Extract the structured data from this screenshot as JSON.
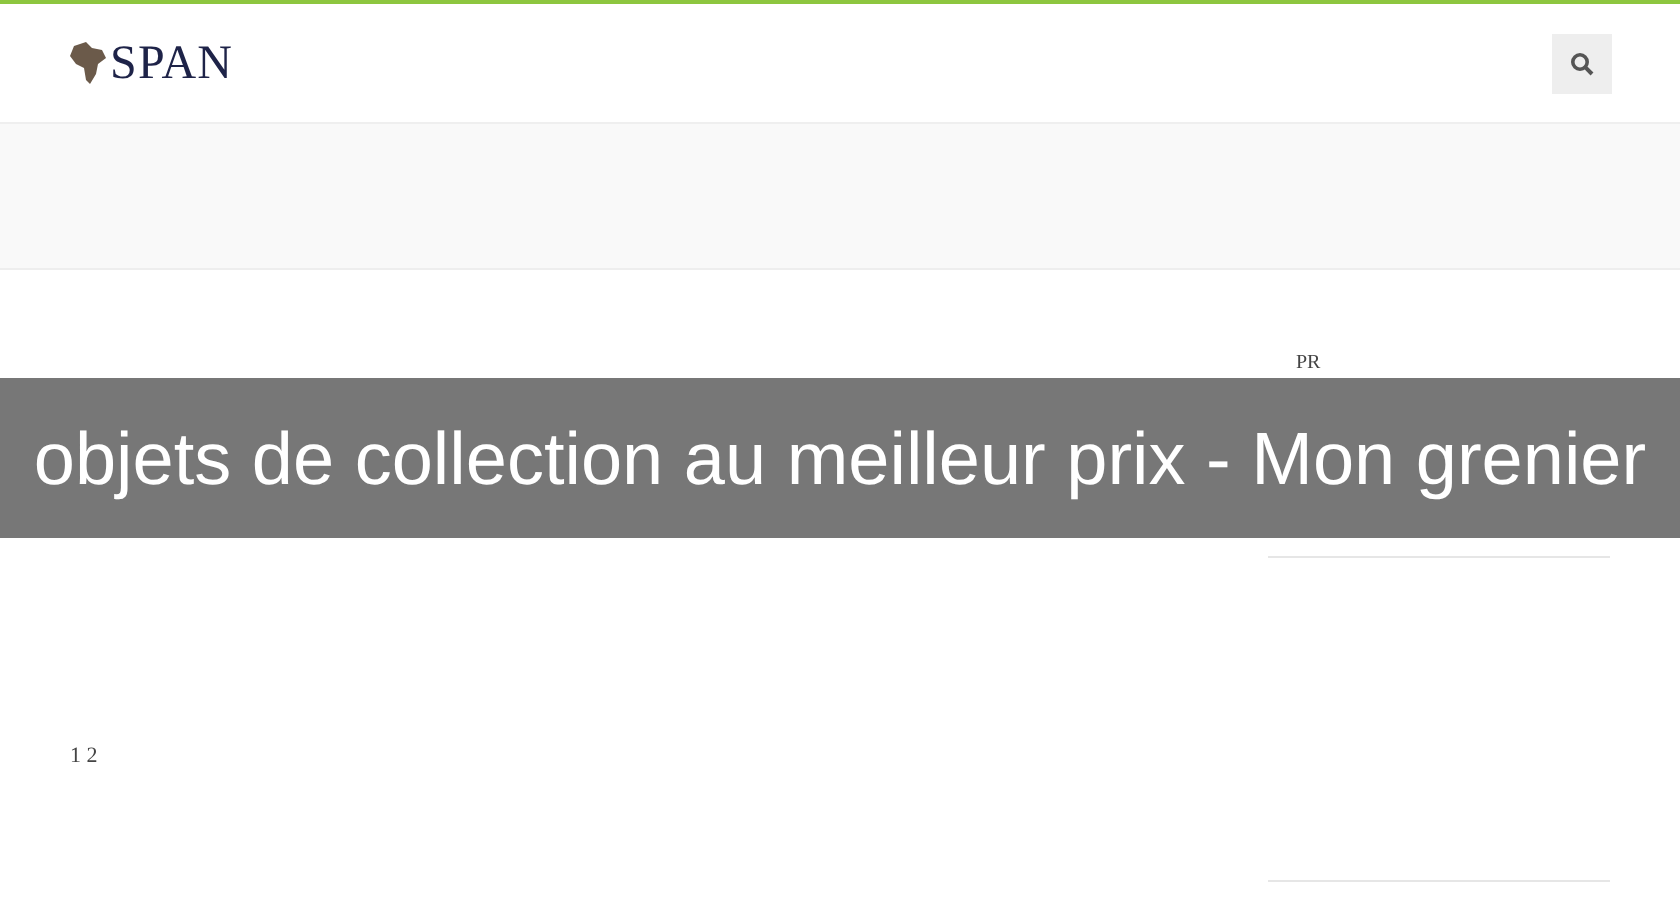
{
  "header": {
    "logo_text": "SPAN"
  },
  "banner": {
    "title": "objets de collection au meilleur prix - Mon grenier"
  },
  "sidebar": {
    "label": "PR"
  },
  "pagination": {
    "text": "1 2"
  }
}
